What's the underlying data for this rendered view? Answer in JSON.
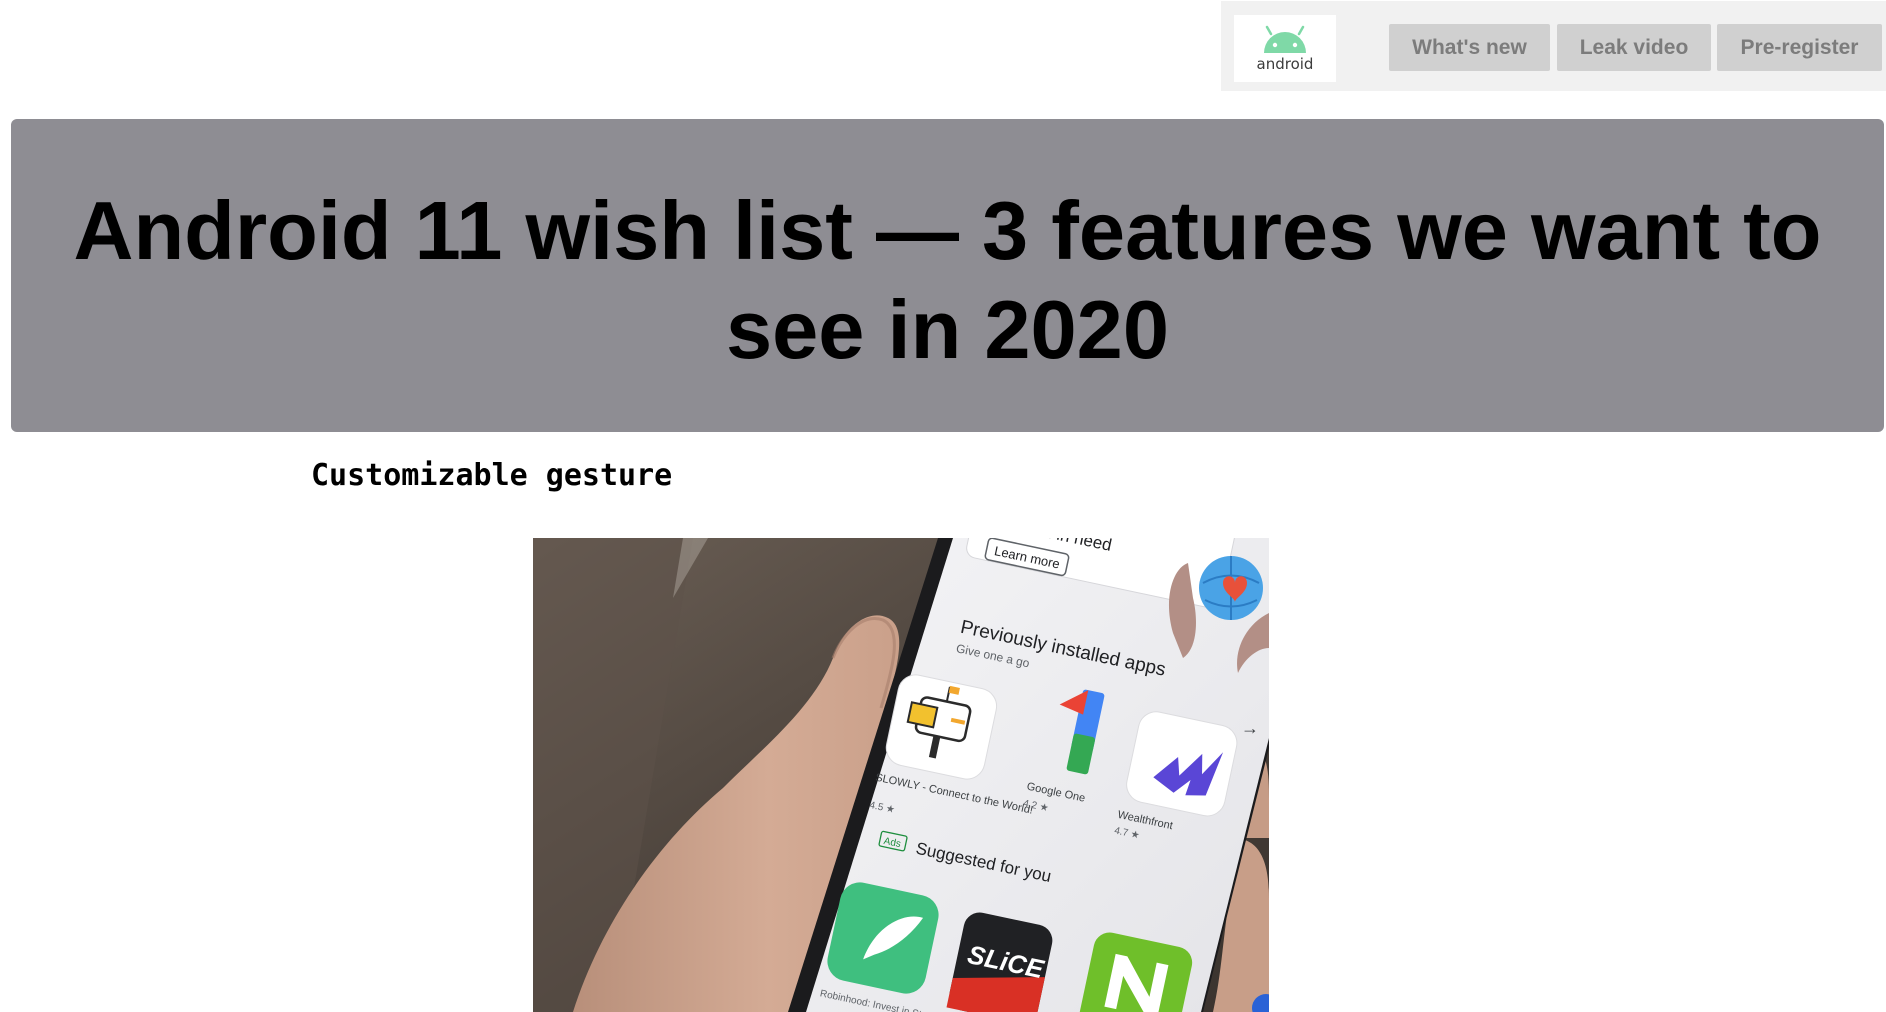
{
  "nav": {
    "logo_text": "android",
    "buttons": [
      "What's new",
      "Leak video",
      "Pre-register"
    ]
  },
  "hero": {
    "title": "Android 11 wish list — 3 features we want to see in 2020"
  },
  "section": {
    "heading": "Customizable gesture"
  },
  "photo": {
    "banner_tail": "en in need",
    "learn_more": "Learn more",
    "previously_installed": "Previously installed apps",
    "give_one_a_go": "Give one a go",
    "apps": [
      {
        "name": "SLOWLY - Connect to the World!",
        "rating": "4.5 ★"
      },
      {
        "name": "Google One",
        "rating": "4.2 ★"
      },
      {
        "name": "Wealthfront",
        "rating": "4.7 ★"
      }
    ],
    "ads_badge": "Ads",
    "suggested_for_you": "Suggested for you",
    "slice_label": "SLiCE",
    "robinhood_caption": "Robinhood: Invest in Stock, Opt..."
  },
  "colors": {
    "hero_bg": "#8e8d93",
    "topbar_bg": "#f1f1f1",
    "button_bg": "#d0d0d0",
    "button_text": "#7c7c7c",
    "android_green": "#3ddc84"
  }
}
